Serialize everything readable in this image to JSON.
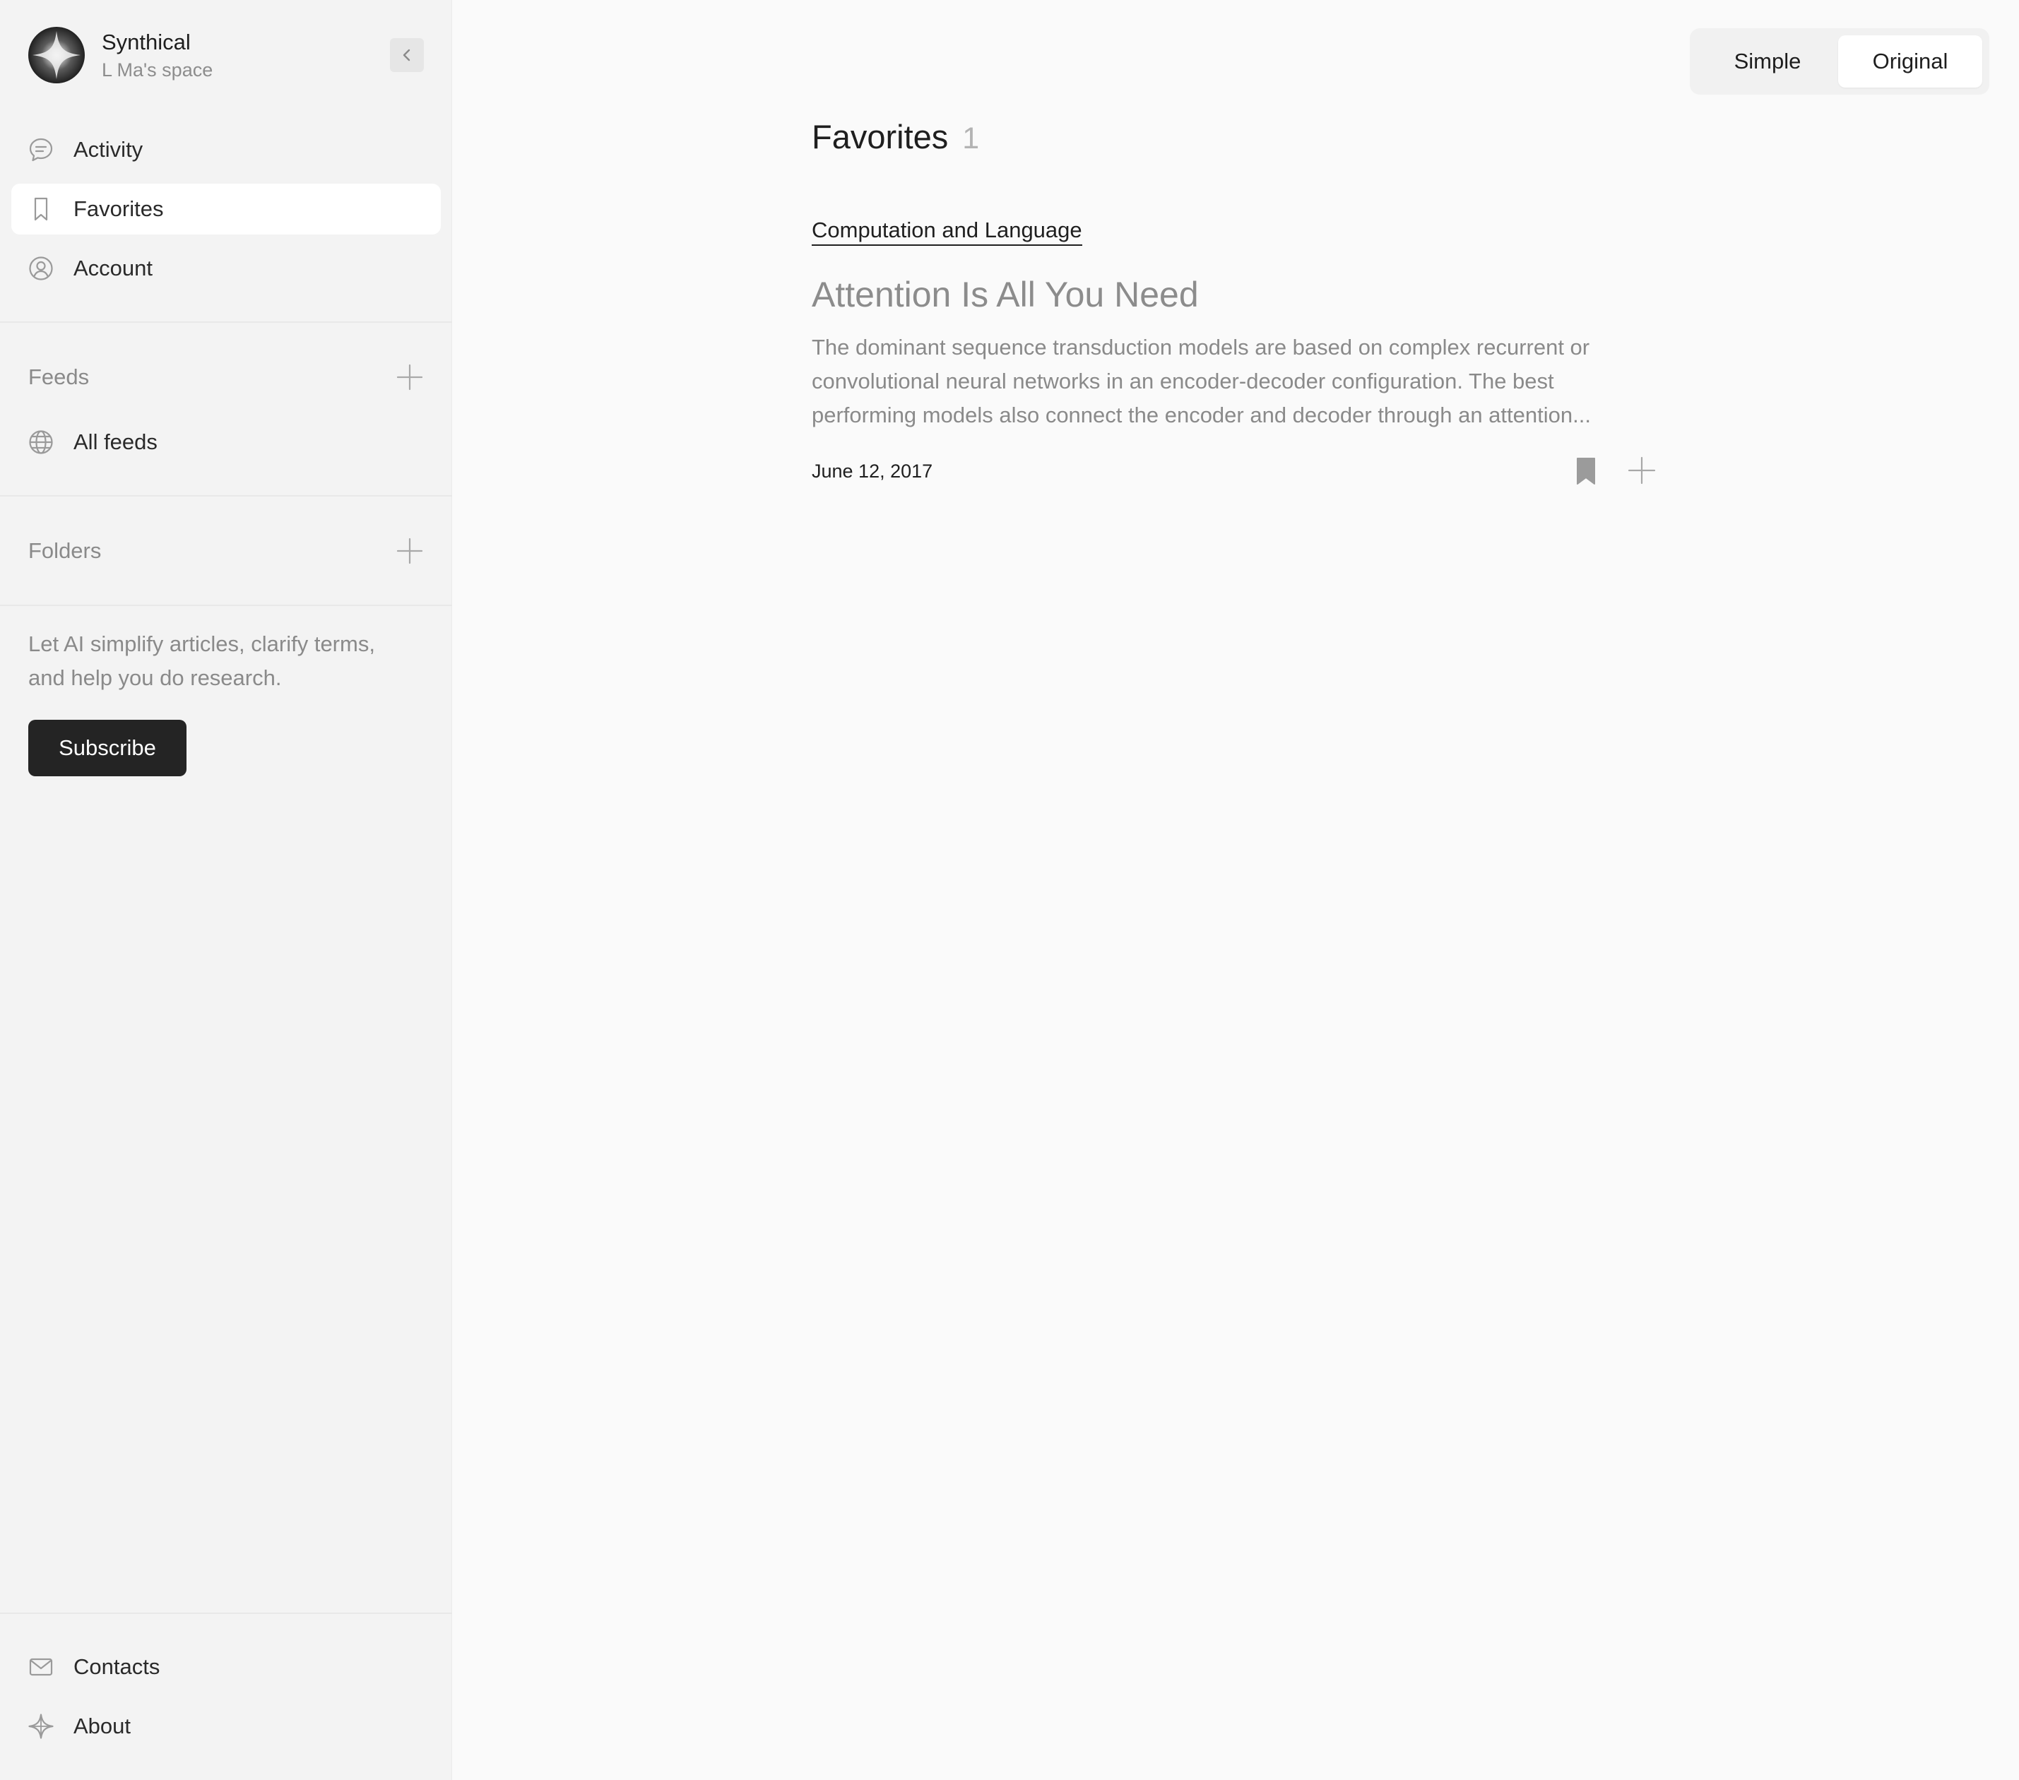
{
  "brand": {
    "name": "Synthical",
    "space": "L Ma's space"
  },
  "sidebar": {
    "nav": [
      {
        "label": "Activity",
        "icon": "chat-bubble-icon"
      },
      {
        "label": "Favorites",
        "icon": "bookmark-icon",
        "active": true
      },
      {
        "label": "Account",
        "icon": "user-circle-icon"
      }
    ],
    "feeds": {
      "label": "Feeds",
      "items": [
        {
          "label": "All feeds",
          "icon": "globe-icon"
        }
      ]
    },
    "folders": {
      "label": "Folders"
    },
    "promo": {
      "text": "Let AI simplify articles, clarify terms, and help you do research.",
      "button": "Subscribe"
    },
    "footer": [
      {
        "label": "Contacts",
        "icon": "envelope-icon"
      },
      {
        "label": "About",
        "icon": "sparkle-icon"
      }
    ]
  },
  "view_toggle": {
    "options": [
      "Simple",
      "Original"
    ],
    "selected": "Original"
  },
  "main": {
    "title": "Favorites",
    "count": "1",
    "articles": [
      {
        "category": "Computation and Language",
        "title": "Attention Is All You Need",
        "abstract": "The dominant sequence transduction models are based on complex recurrent or convolutional neural networks in an encoder-decoder configuration. The best performing models also connect the encoder and decoder through an attention...",
        "date": "June 12, 2017",
        "bookmarked": true
      }
    ]
  },
  "colors": {
    "sidebar_bg": "#f3f3f3",
    "main_bg": "#fafafa",
    "button_dark": "#242424",
    "muted_text": "#8a8a8a"
  }
}
